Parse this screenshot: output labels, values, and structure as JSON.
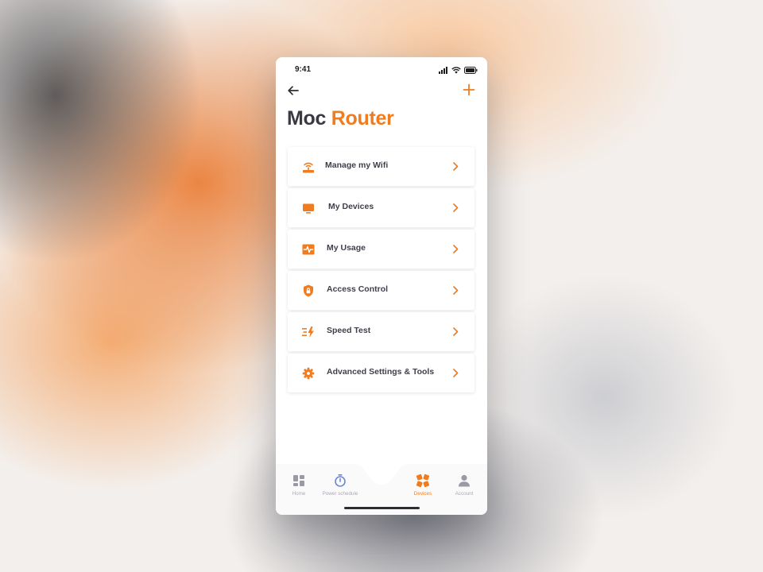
{
  "status_bar": {
    "time": "9:41"
  },
  "nav": {
    "back_icon": "arrow-left-icon",
    "add_icon": "plus-icon"
  },
  "page": {
    "title_main": "Moc",
    "title_accent": "Router"
  },
  "colors": {
    "accent": "#f07c1f",
    "text": "#3f3f4a",
    "tab_inactive": "#a9a9b3",
    "tab_blue": "#6d86d4"
  },
  "menu": {
    "items": [
      {
        "label": "Manage my Wifi",
        "icon": "router-wifi-icon"
      },
      {
        "label": "My Devices",
        "icon": "monitor-icon"
      },
      {
        "label": "My Usage",
        "icon": "activity-icon"
      },
      {
        "label": "Access Control",
        "icon": "shield-lock-icon"
      },
      {
        "label": "Speed Test",
        "icon": "speed-bolt-icon"
      },
      {
        "label": "Advanced Settings & Tools",
        "icon": "gear-icon"
      }
    ]
  },
  "tabbar": {
    "tabs": [
      {
        "label": "Home",
        "icon": "dashboard-icon",
        "active": false
      },
      {
        "label": "Power schedule",
        "icon": "timer-icon",
        "active": false
      },
      {
        "label": "Devices",
        "icon": "devices-icon",
        "active": true
      },
      {
        "label": "Account",
        "icon": "user-icon",
        "active": false
      }
    ]
  }
}
